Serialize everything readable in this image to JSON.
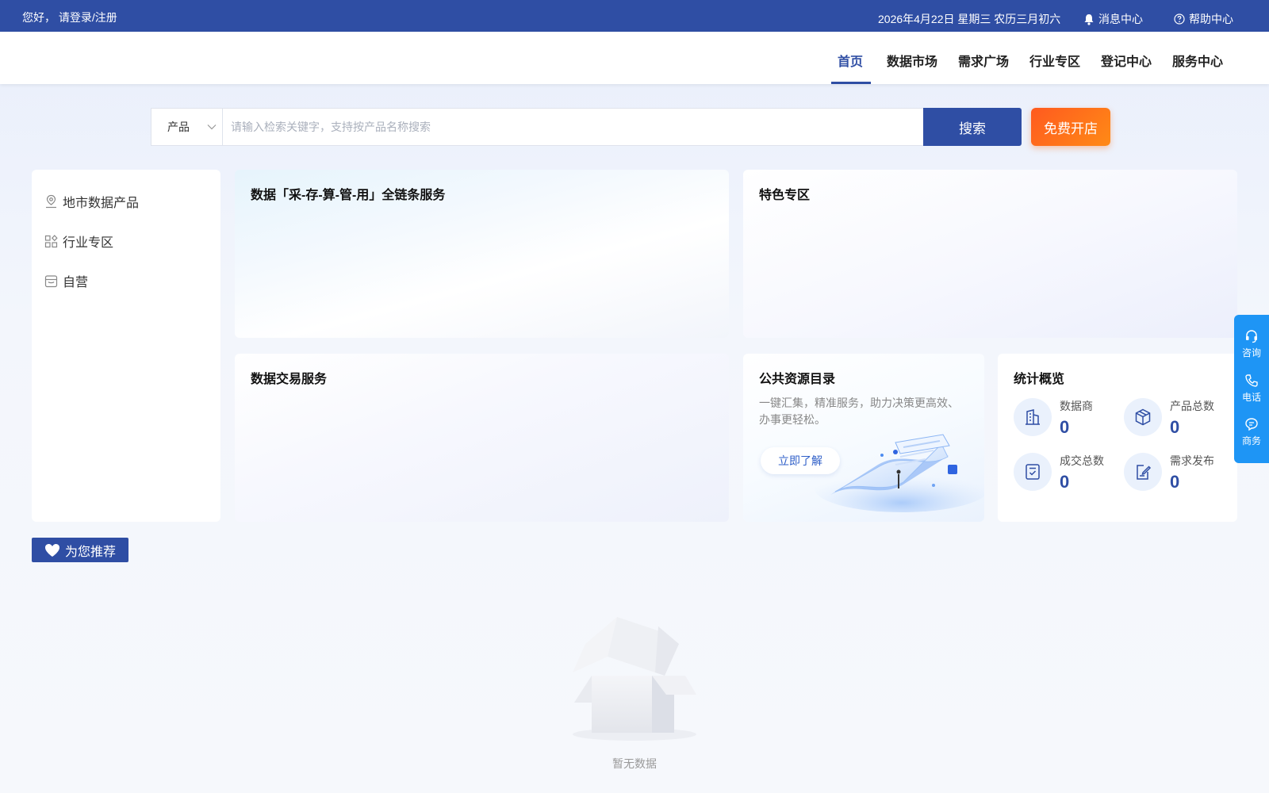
{
  "topbar": {
    "greeting": "您好， 请登录/注册",
    "date": "2026年4月22日  星期三  农历三月初六",
    "messages": "消息中心",
    "help": "帮助中心"
  },
  "nav": {
    "items": [
      {
        "label": "首页",
        "active": true
      },
      {
        "label": "数据市场"
      },
      {
        "label": "需求广场"
      },
      {
        "label": "行业专区"
      },
      {
        "label": "登记中心"
      },
      {
        "label": "服务中心"
      }
    ]
  },
  "search": {
    "type_selected": "产品",
    "placeholder": "请输入检索关键字，支持按产品名称搜索",
    "value": "",
    "button": "搜索",
    "open_button": "免费开店"
  },
  "sidebar": {
    "items": [
      {
        "label": "地市数据产品",
        "icon": "location-icon"
      },
      {
        "label": "行业专区",
        "icon": "grid-icon"
      },
      {
        "label": "自营",
        "icon": "store-icon"
      }
    ]
  },
  "cards": {
    "fullchain": {
      "title": "数据「采-存-算-管-用」全链条服务"
    },
    "featured": {
      "title": "特色专区"
    },
    "trade": {
      "title": "数据交易服务"
    },
    "catalog": {
      "title": "公共资源目录",
      "description": "一键汇集，精准服务，助力决策更高效、办事更轻松。",
      "button": "立即了解"
    },
    "stats": {
      "title": "统计概览",
      "items": [
        {
          "label": "数据商",
          "value": "0",
          "icon": "building-icon"
        },
        {
          "label": "产品总数",
          "value": "0",
          "icon": "cube-icon"
        },
        {
          "label": "成交总数",
          "value": "0",
          "icon": "check-doc-icon"
        },
        {
          "label": "需求发布",
          "value": "0",
          "icon": "edit-doc-icon"
        }
      ]
    }
  },
  "recommend": {
    "label": "为您推荐",
    "empty_text": "暂无数据"
  },
  "float_bar": {
    "items": [
      {
        "label": "咨询",
        "icon": "headset-icon"
      },
      {
        "label": "电话",
        "icon": "phone-icon"
      },
      {
        "label": "商务",
        "icon": "chat-icon"
      }
    ]
  },
  "colors": {
    "primary": "#2f4ea4",
    "accent_orange": "#ff6a1a",
    "float_blue": "#1e95f5"
  }
}
